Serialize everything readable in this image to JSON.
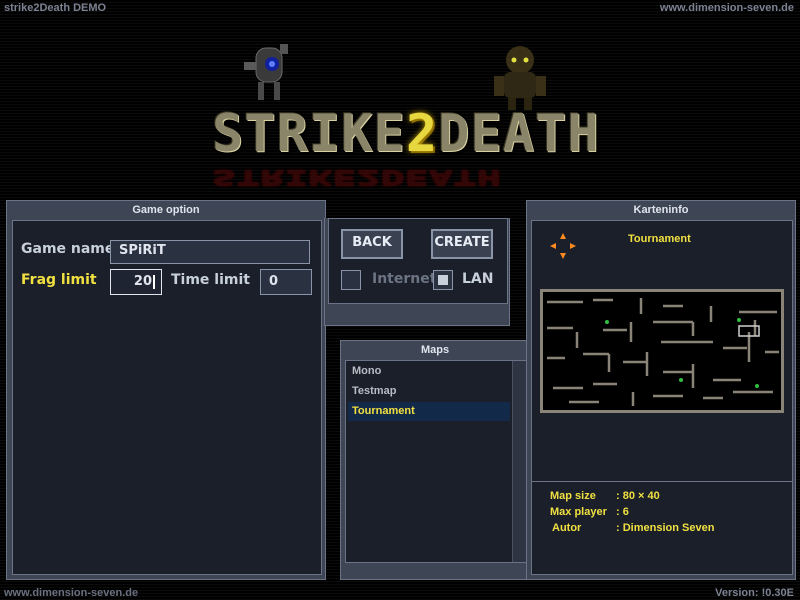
{
  "window": {
    "title": "strike2Death  DEMO",
    "url_top": "www.dimension-seven.de",
    "url_bottom": "www.dimension-seven.de",
    "version": "Version: !0.30E"
  },
  "logo": {
    "text_a": "STRIKE",
    "text_2": "2",
    "text_b": "DEATH"
  },
  "game_option": {
    "header": "Game option",
    "game_name_label": "Game name",
    "game_name_value": "SPiRiT",
    "frag_limit_label": "Frag limit",
    "frag_limit_value": "20",
    "time_limit_label": "Time limit",
    "time_limit_value": "0"
  },
  "actions": {
    "back_label": "BACK",
    "create_label": "CREATE",
    "internet_label": "Internet",
    "internet_checked": false,
    "lan_label": "LAN",
    "lan_checked": true
  },
  "maps": {
    "header": "Maps",
    "items": [
      {
        "label": "Mono",
        "selected": false
      },
      {
        "label": "Testmap",
        "selected": false
      },
      {
        "label": "Tournament",
        "selected": true
      }
    ]
  },
  "map_info": {
    "header": "Karteninfo",
    "map_name": "Tournament",
    "map_size_label": "Map size",
    "map_size_value": ": 80 × 40",
    "max_player_label": "Max player",
    "max_player_value": ": 6",
    "autor_label": "Autor",
    "autor_value": ": Dimension Seven"
  },
  "colors": {
    "panel": "#3e4656",
    "highlight": "#f0e040",
    "selection": "#13294a"
  }
}
